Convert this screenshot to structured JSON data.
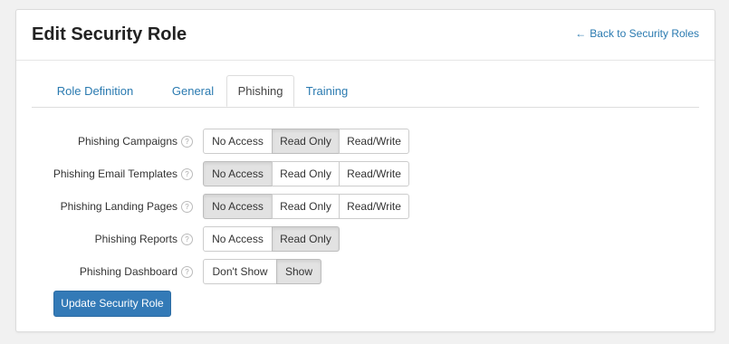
{
  "header": {
    "title": "Edit Security Role",
    "back_link": "Back to Security Roles",
    "back_icon": "arrow-left-icon"
  },
  "tabs": [
    {
      "label": "Role Definition",
      "active": false
    },
    {
      "label": "General",
      "active": false
    },
    {
      "label": "Phishing",
      "active": true
    },
    {
      "label": "Training",
      "active": false
    }
  ],
  "help_glyph": "?",
  "permissions": [
    {
      "label": "Phishing Campaigns",
      "options": [
        "No Access",
        "Read Only",
        "Read/Write"
      ],
      "selected": "Read Only"
    },
    {
      "label": "Phishing Email Templates",
      "options": [
        "No Access",
        "Read Only",
        "Read/Write"
      ],
      "selected": "No Access"
    },
    {
      "label": "Phishing Landing Pages",
      "options": [
        "No Access",
        "Read Only",
        "Read/Write"
      ],
      "selected": "No Access"
    },
    {
      "label": "Phishing Reports",
      "options": [
        "No Access",
        "Read Only"
      ],
      "selected": "Read Only"
    },
    {
      "label": "Phishing Dashboard",
      "options": [
        "Don't Show",
        "Show"
      ],
      "selected": "Show"
    }
  ],
  "submit_label": "Update Security Role",
  "colors": {
    "accent": "#337ab7",
    "link": "#2a7ab0"
  }
}
